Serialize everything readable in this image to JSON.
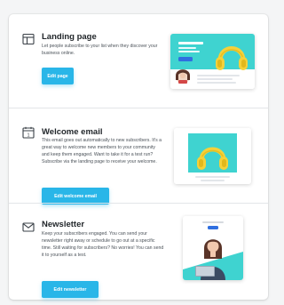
{
  "cards": [
    {
      "icon": "layout-icon",
      "title": "Landing page",
      "description": "Let people subscribe to your list when they discover your business online.",
      "button": "Edit page"
    },
    {
      "icon": "calendar-icon",
      "title": "Welcome email",
      "description": "This email goes out automatically to new subscribers. It's a great way to welcome new members to your community and keep them engaged. Want to take it for a test run? Subscribe via the landing page to receive your welcome.",
      "button": "Edit welcome email"
    },
    {
      "icon": "envelope-icon",
      "title": "Newsletter",
      "description": "Keep your subscribers engaged. You can send your newsletter right away or schedule to go out at a specific time. Still waiting for subscribers? No worries! You can send it to yourself as a test.",
      "button": "Edit newsletter"
    }
  ],
  "colors": {
    "accent": "#29b6e8",
    "teal": "#3fd3d0",
    "headphones": "#f5d13a"
  }
}
